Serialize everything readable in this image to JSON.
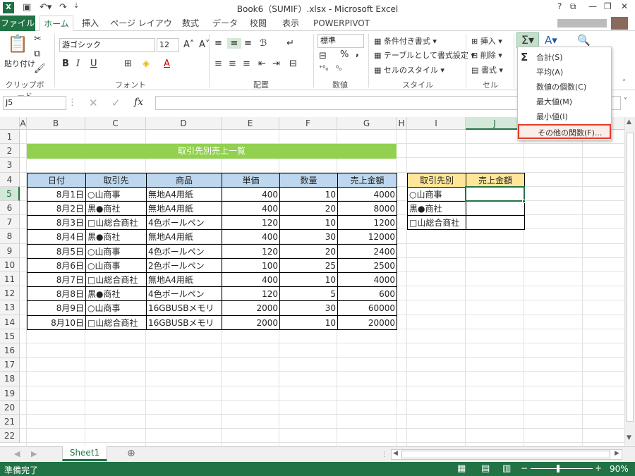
{
  "window": {
    "title": "Book6（SUMIF）.xlsx - Microsoft Excel",
    "app_icon": "X"
  },
  "tabs": [
    "ファイル",
    "ホーム",
    "挿入",
    "ページ レイアウト",
    "数式",
    "データ",
    "校閲",
    "表示",
    "POWERPIVOT"
  ],
  "ribbon": {
    "clipboard": {
      "paste_label": "貼り付け",
      "group": "クリップボード"
    },
    "font": {
      "name": "游ゴシック",
      "size": "12",
      "bold": "B",
      "italic": "I",
      "underline": "U",
      "group": "フォント"
    },
    "alignment": {
      "group": "配置"
    },
    "number": {
      "format": "標準",
      "percent": "%",
      "comma": ",",
      "group": "数値"
    },
    "styles": {
      "conditional": "条件付き書式",
      "table": "テーブルとして書式設定",
      "cell": "セルのスタイル",
      "group": "スタイル"
    },
    "cells": {
      "insert": "挿入",
      "delete": "削除",
      "format": "書式",
      "group": "セル"
    }
  },
  "formula_bar": {
    "name_box": "J5",
    "fx": "fx",
    "value": ""
  },
  "columns": [
    "A",
    "B",
    "C",
    "D",
    "E",
    "F",
    "G",
    "H",
    "I",
    "J"
  ],
  "rows": [
    "1",
    "2",
    "3",
    "4",
    "5",
    "6",
    "7",
    "8",
    "9",
    "10",
    "11",
    "12",
    "13",
    "14",
    "15",
    "16",
    "17",
    "18",
    "19",
    "20",
    "21",
    "22"
  ],
  "table_title": "取引先別売上一覧",
  "table": {
    "headers": [
      "日付",
      "取引先",
      "商品",
      "単価",
      "数量",
      "売上金額"
    ],
    "rows": [
      [
        "8月1日",
        "○山商事",
        "無地A4用紙",
        "400",
        "10",
        "4000"
      ],
      [
        "8月2日",
        "黒●商社",
        "無地A4用紙",
        "400",
        "20",
        "8000"
      ],
      [
        "8月3日",
        "□山総合商社",
        "4色ボールペン",
        "120",
        "10",
        "1200"
      ],
      [
        "8月4日",
        "黒●商社",
        "無地A4用紙",
        "400",
        "30",
        "12000"
      ],
      [
        "8月5日",
        "○山商事",
        "4色ボールペン",
        "120",
        "20",
        "2400"
      ],
      [
        "8月6日",
        "○山商事",
        "2色ボールペン",
        "100",
        "25",
        "2500"
      ],
      [
        "8月7日",
        "□山総合商社",
        "無地A4用紙",
        "400",
        "10",
        "4000"
      ],
      [
        "8月8日",
        "黒●商社",
        "4色ボールペン",
        "120",
        "5",
        "600"
      ],
      [
        "8月9日",
        "○山商事",
        "16GBUSBメモリ",
        "2000",
        "30",
        "60000"
      ],
      [
        "8月10日",
        "□山総合商社",
        "16GBUSBメモリ",
        "2000",
        "10",
        "20000"
      ]
    ]
  },
  "summary": {
    "headers": [
      "取引先別",
      "売上金額"
    ],
    "rows": [
      [
        "○山商事",
        ""
      ],
      [
        "黒●商社",
        ""
      ],
      [
        "□山総合商社",
        ""
      ]
    ]
  },
  "autosum_menu": {
    "items": [
      "合計(S)",
      "平均(A)",
      "数値の個数(C)",
      "最大値(M)",
      "最小値(I)",
      "その他の関数(F)..."
    ],
    "highlighted_index": 5,
    "highlight_color": "#e03c28"
  },
  "sheets": [
    "Sheet1"
  ],
  "status": {
    "ready": "準備完了",
    "zoom": "90%"
  },
  "colors": {
    "brand": "#217346",
    "header_blue": "#bdd7ee",
    "header_orange": "#ffe699",
    "title_green": "#92d050"
  }
}
